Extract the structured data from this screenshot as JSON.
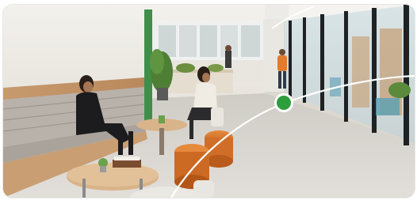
{
  "photo": {
    "scene": "office-lounge-corridor",
    "colors": {
      "wall": "#efece6",
      "wood": "#c79a6d",
      "sofa": "#b8b2ab",
      "carpet": "#d9d5cf",
      "orange": "#d9772f",
      "glass_frame": "#1f2224",
      "green_beam": "#3f8f4a",
      "accent_marker": "#2e9e3c",
      "overlay_line": "#ffffff"
    }
  },
  "overlay": {
    "marker_icon": "location-dot-icon"
  }
}
